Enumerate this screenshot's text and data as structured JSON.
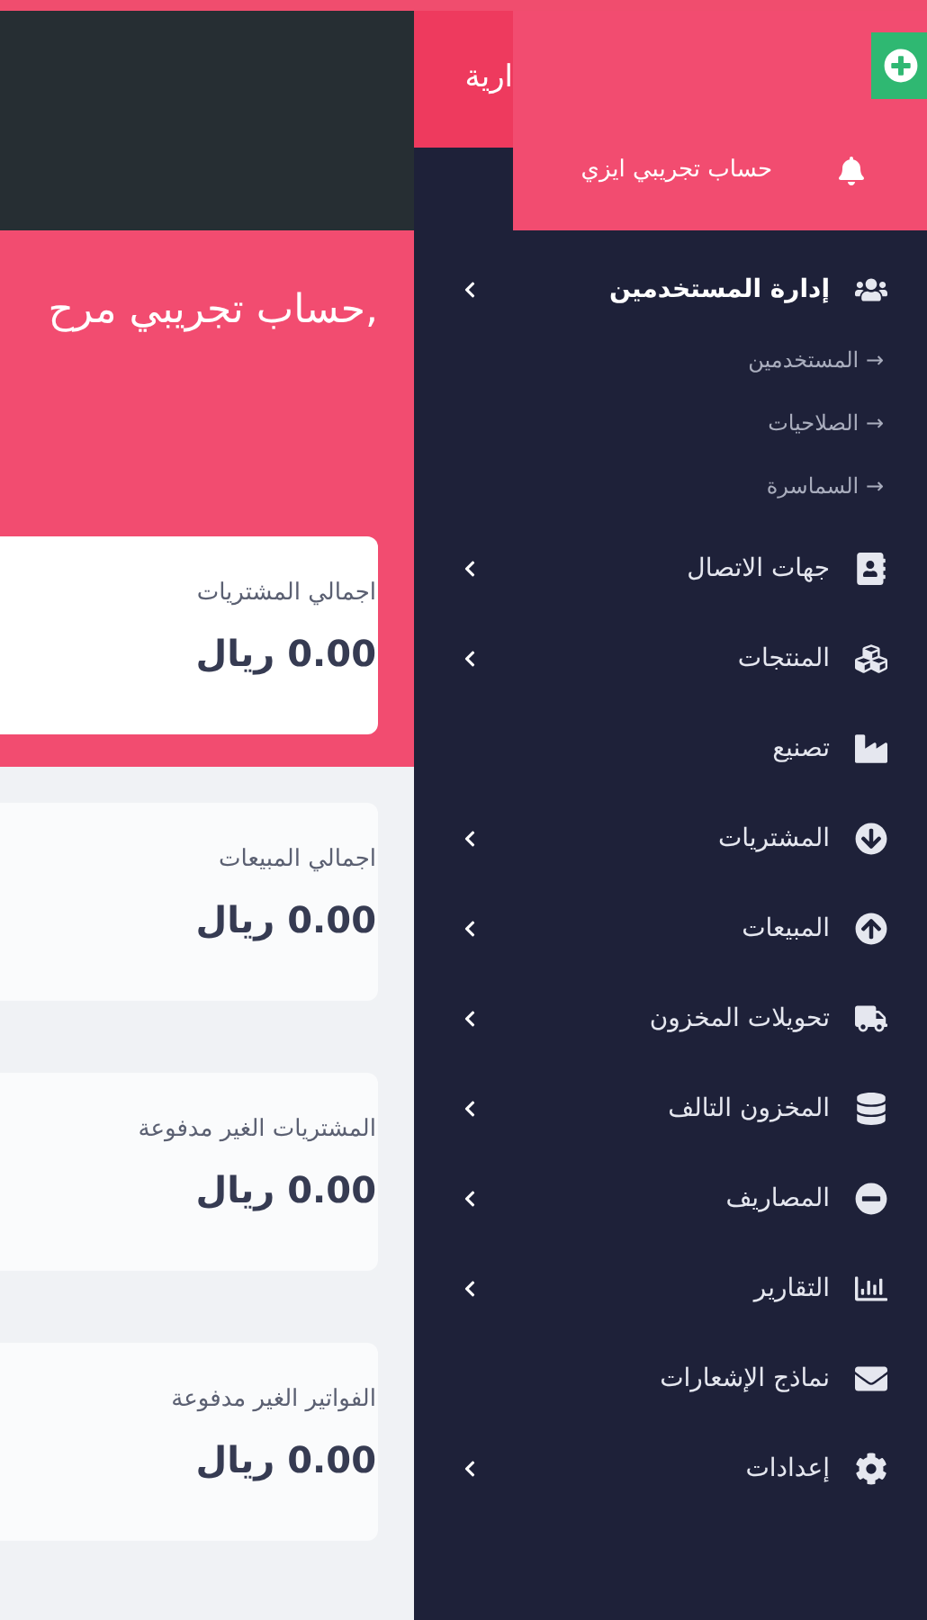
{
  "header": {
    "section_tab": "ارية",
    "account_name": "حساب تجريبي ايزي"
  },
  "welcome": "حساب تجريبي مرح,",
  "cards": [
    {
      "label": "اجمالي المشتريات",
      "value": "0.00 ريال",
      "highlighted": true
    },
    {
      "label": "اجمالي المبيعات",
      "value": "0.00 ريال",
      "highlighted": false
    },
    {
      "label": "المشتريات الغير مدفوعة",
      "value": "0.00 ريال",
      "highlighted": false
    },
    {
      "label": "الفواتير الغير مدفوعة",
      "value": "0.00 ريال",
      "highlighted": false
    }
  ],
  "sidebar": {
    "items": [
      {
        "label": "إدارة المستخدمين",
        "has_submenu": true,
        "children": [
          {
            "label": "→ المستخدمين"
          },
          {
            "label": "→ الصلاحيات"
          },
          {
            "label": "→ السماسرة"
          }
        ]
      },
      {
        "label": "جهات الاتصال",
        "has_submenu": true
      },
      {
        "label": "المنتجات",
        "has_submenu": true
      },
      {
        "label": "تصنيع",
        "has_submenu": false
      },
      {
        "label": "المشتريات",
        "has_submenu": true
      },
      {
        "label": "المبيعات",
        "has_submenu": true
      },
      {
        "label": "تحويلات المخزون",
        "has_submenu": true
      },
      {
        "label": "المخزون التالف",
        "has_submenu": true
      },
      {
        "label": "المصاريف",
        "has_submenu": true
      },
      {
        "label": "التقارير",
        "has_submenu": true
      },
      {
        "label": "نماذج الإشعارات",
        "has_submenu": false
      },
      {
        "label": "إعدادات",
        "has_submenu": true
      }
    ]
  }
}
